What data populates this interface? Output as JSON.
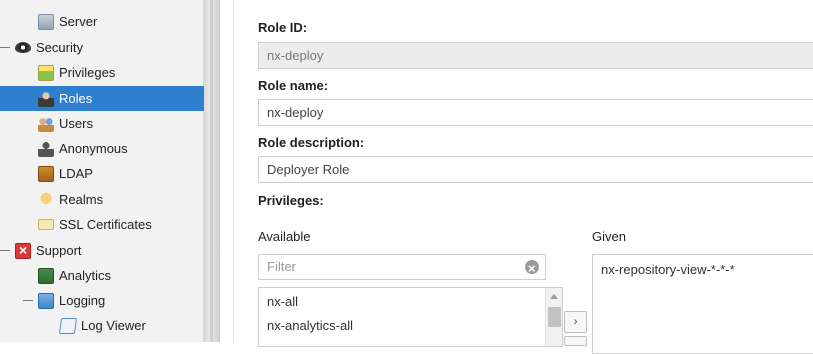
{
  "sidebar": {
    "items": [
      {
        "label": "Server",
        "icon": "server-icon"
      },
      {
        "label": "Security",
        "icon": "security-icon"
      },
      {
        "label": "Privileges",
        "icon": "privileges-icon"
      },
      {
        "label": "Roles",
        "icon": "roles-icon",
        "selected": true
      },
      {
        "label": "Users",
        "icon": "users-icon"
      },
      {
        "label": "Anonymous",
        "icon": "anonymous-icon"
      },
      {
        "label": "LDAP",
        "icon": "ldap-icon"
      },
      {
        "label": "Realms",
        "icon": "realms-icon"
      },
      {
        "label": "SSL Certificates",
        "icon": "ssl-certificates-icon"
      },
      {
        "label": "Support",
        "icon": "support-icon"
      },
      {
        "label": "Analytics",
        "icon": "analytics-icon"
      },
      {
        "label": "Logging",
        "icon": "logging-icon"
      },
      {
        "label": "Log Viewer",
        "icon": "log-viewer-icon"
      }
    ]
  },
  "form": {
    "role_id_label": "Role ID:",
    "role_id_value": "nx-deploy",
    "role_name_label": "Role name:",
    "role_name_value": "nx-deploy",
    "role_description_label": "Role description:",
    "role_description_value": "Deployer Role",
    "privileges_label": "Privileges:"
  },
  "privileges": {
    "available_label": "Available",
    "given_label": "Given",
    "filter_placeholder": "Filter",
    "available_items": [
      "nx-all",
      "nx-analytics-all"
    ],
    "given_items": [
      "nx-repository-view-*-*-*"
    ],
    "move_right_symbol": "›"
  },
  "colors": {
    "selection": "#2f7fd0",
    "sidebar_bg": "#f2f2f2",
    "readonly_bg": "#ececec"
  }
}
